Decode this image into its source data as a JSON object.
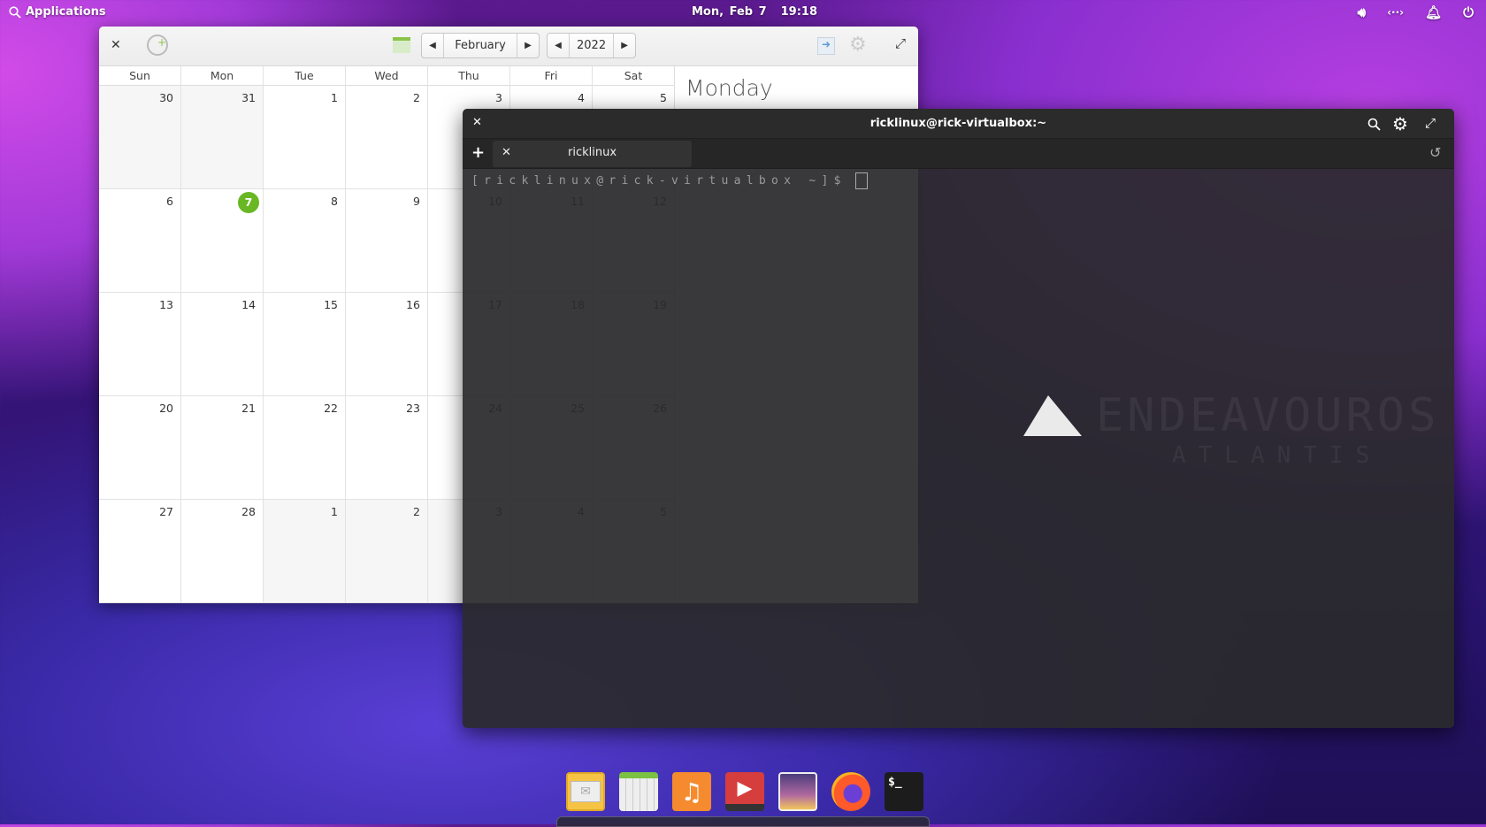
{
  "panel": {
    "applications_label": "Applications",
    "date": "Mon, Feb 7",
    "time": "19:18",
    "tray_icons": [
      "volume-icon",
      "network-icon",
      "notification-bell-icon",
      "power-icon"
    ]
  },
  "calendar": {
    "month": "February",
    "year": "2022",
    "weekdays": [
      "Sun",
      "Mon",
      "Tue",
      "Wed",
      "Thu",
      "Fri",
      "Sat"
    ],
    "weeks": [
      [
        30,
        31,
        1,
        2,
        3,
        4,
        5
      ],
      [
        6,
        7,
        8,
        9,
        10,
        11,
        12
      ],
      [
        13,
        14,
        15,
        16,
        17,
        18,
        19
      ],
      [
        20,
        21,
        22,
        23,
        24,
        25,
        26
      ],
      [
        27,
        28,
        1,
        2,
        3,
        4,
        5
      ]
    ],
    "other_month": [
      [
        true,
        true,
        false,
        false,
        false,
        false,
        false
      ],
      [
        false,
        false,
        false,
        false,
        false,
        false,
        false
      ],
      [
        false,
        false,
        false,
        false,
        false,
        false,
        false
      ],
      [
        false,
        false,
        false,
        false,
        false,
        false,
        false
      ],
      [
        false,
        false,
        true,
        true,
        true,
        true,
        true
      ]
    ],
    "today": 7,
    "today_color": "#68b723",
    "side_heading": "Monday"
  },
  "terminal": {
    "title": "ricklinux@rick-virtualbox:~",
    "tab_label": "ricklinux",
    "prompt": "[ricklinux@rick-virtualbox ~]$"
  },
  "wallpaper": {
    "logo_text": "ENDEAVOUROS",
    "logo_subtext": "ATLANTIS"
  },
  "dock": {
    "apps": [
      "mail",
      "calendar",
      "music",
      "videos",
      "photos",
      "firefox",
      "terminal"
    ]
  }
}
